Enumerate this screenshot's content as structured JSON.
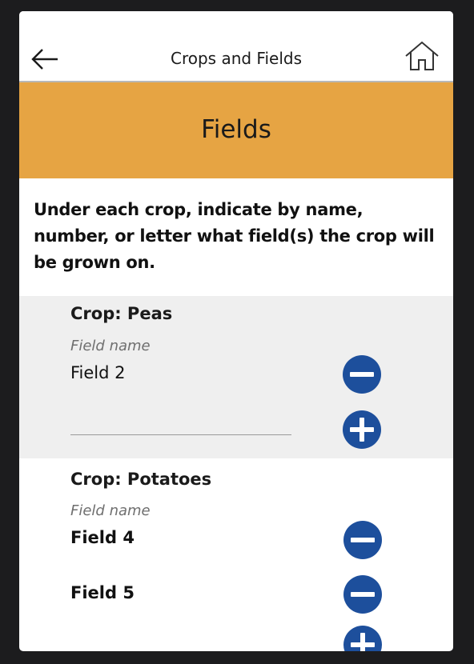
{
  "header": {
    "title": "Crops and Fields",
    "back_icon": "arrow-left-icon",
    "home_icon": "home-icon"
  },
  "banner": {
    "title": "Fields",
    "color": "#e6a443"
  },
  "instructions": "Under each crop, indicate by name, number, or letter what field(s) the crop will be grown on.",
  "crops": [
    {
      "title": "Crop: Peas",
      "field_label": "Field name",
      "fields": [
        "Field 2"
      ],
      "new_field_value": ""
    },
    {
      "title": "Crop: Potatoes",
      "field_label": "Field name",
      "fields": [
        "Field 4",
        "Field 5"
      ]
    }
  ],
  "colors": {
    "accent_button": "#1d4f9c",
    "section_background": "#efefef"
  }
}
